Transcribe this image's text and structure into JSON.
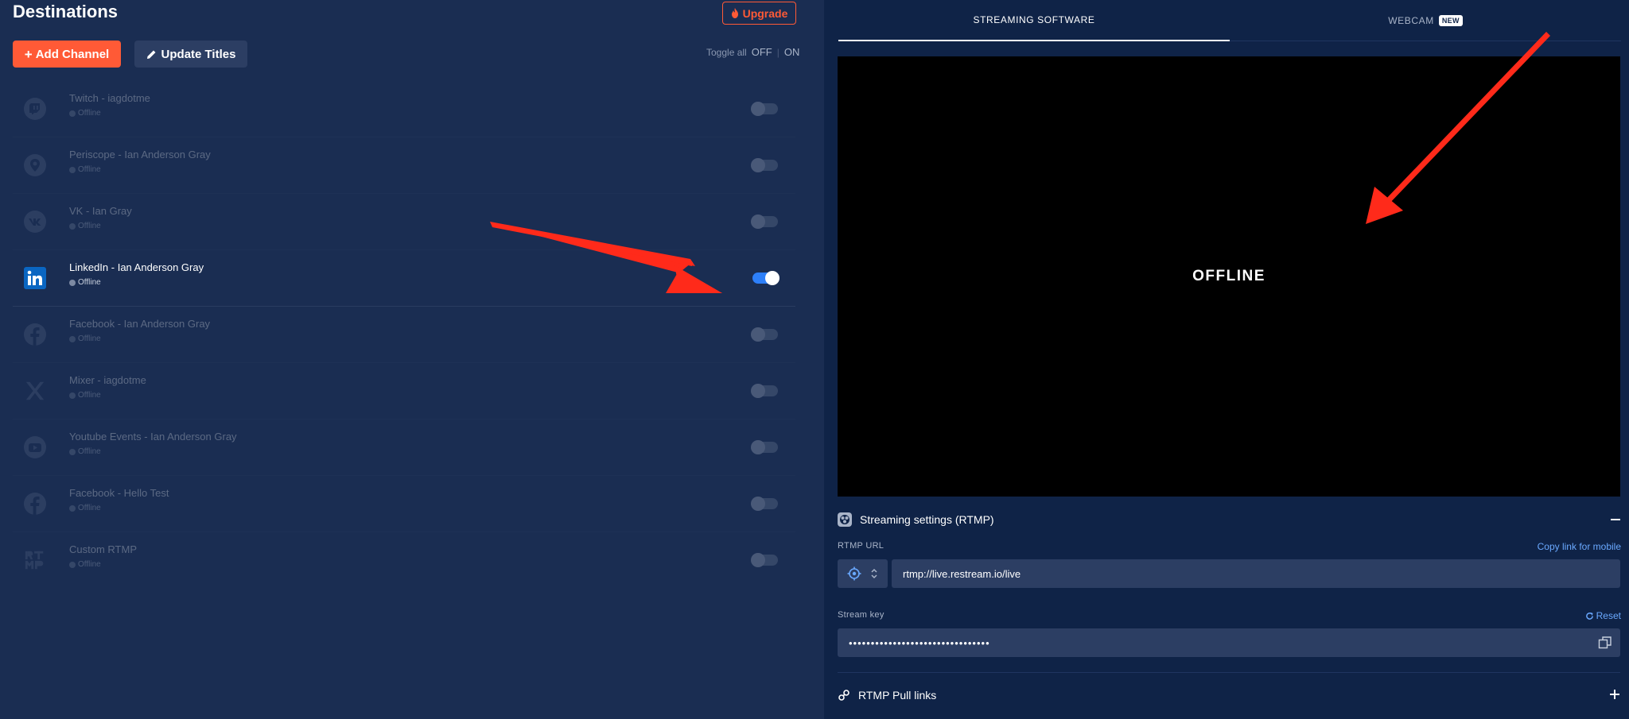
{
  "left": {
    "title": "Destinations",
    "upgrade_label": "Upgrade",
    "add_channel_label": "Add Channel",
    "update_titles_label": "Update Titles",
    "toggle_all": {
      "label": "Toggle all",
      "off": "OFF",
      "on": "ON"
    },
    "channels": [
      {
        "name": "Twitch - iagdotme",
        "status": "Offline",
        "icon": "twitch-icon",
        "enabled": false
      },
      {
        "name": "Periscope - Ian Anderson Gray",
        "status": "Offline",
        "icon": "periscope-icon",
        "enabled": false
      },
      {
        "name": "VK - Ian Gray",
        "status": "Offline",
        "icon": "vk-icon",
        "enabled": false
      },
      {
        "name": "LinkedIn - Ian Anderson Gray",
        "status": "Offline",
        "icon": "linkedin-icon",
        "enabled": true
      },
      {
        "name": "Facebook - Ian Anderson Gray",
        "status": "Offline",
        "icon": "facebook-icon",
        "enabled": false
      },
      {
        "name": "Mixer - iagdotme",
        "status": "Offline",
        "icon": "mixer-icon",
        "enabled": false
      },
      {
        "name": "Youtube Events - Ian Anderson Gray",
        "status": "Offline",
        "icon": "youtube-icon",
        "enabled": false
      },
      {
        "name": "Facebook - Hello Test",
        "status": "Offline",
        "icon": "facebook-icon",
        "enabled": false
      },
      {
        "name": "Custom RTMP",
        "status": "Offline",
        "icon": "custom-rtmp-icon",
        "enabled": false
      }
    ]
  },
  "right": {
    "tabs": [
      {
        "label": "STREAMING SOFTWARE",
        "active": true
      },
      {
        "label": "WEBCAM",
        "badge": "NEW",
        "active": false
      }
    ],
    "preview_status": "OFFLINE",
    "settings_title": "Streaming settings (RTMP)",
    "rtmp_url_label": "RTMP URL",
    "copy_link_label": "Copy link for mobile",
    "rtmp_url_value": "rtmp://live.restream.io/live",
    "stream_key_label": "Stream key",
    "reset_label": "Reset",
    "stream_key_value": "••••••••••••••••••••••••••••••••",
    "pull_links_title": "RTMP Pull links"
  },
  "colors": {
    "accent": "#ff5a36",
    "toggle_on": "#2d7ff9",
    "link": "#6aa9ff",
    "panel_left": "#1a2d52",
    "panel_right": "#0f2347",
    "annotation_arrow": "#ff2a1a"
  }
}
